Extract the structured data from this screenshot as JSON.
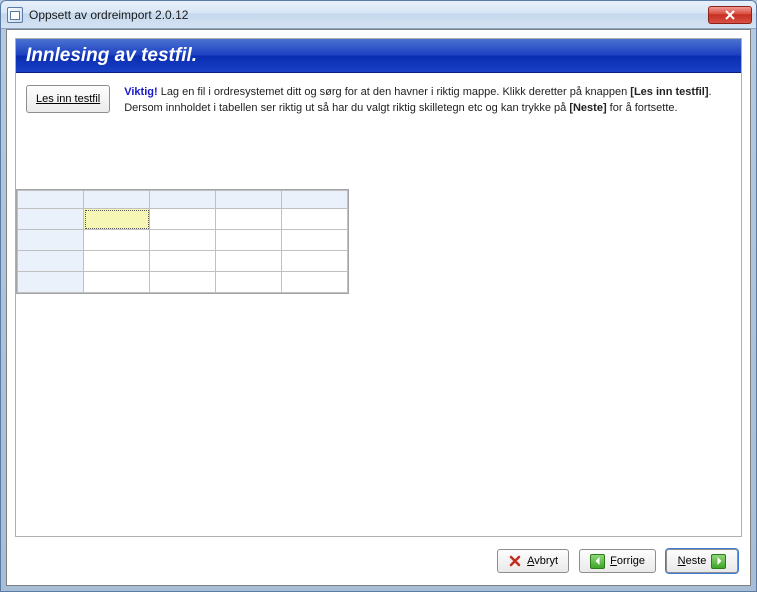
{
  "window": {
    "title": "Oppsett av ordreimport 2.0.12"
  },
  "banner": {
    "title": "Innlesing av testfil."
  },
  "load_button": {
    "label": "Les inn testfil",
    "accel_char": "L"
  },
  "info": {
    "important": "Viktig!",
    "line1_a": " Lag en fil i ordresystemet ditt og sørg for at den havner i riktig mappe. Klikk deretter på knappen ",
    "line1_b": "[Les inn testfil]",
    "line1_c": ". Dersom innholdet i tabellen ser riktig ut så har du valgt riktig skilletegn etc og kan trykke på ",
    "line1_d": "[Neste]",
    "line1_e": " for å fortsette."
  },
  "grid": {
    "cols": 5,
    "rows": 4,
    "selected": {
      "row": 0,
      "col": 0
    }
  },
  "footer": {
    "cancel": "Avbryt",
    "prev": "Forrige",
    "next": "Neste"
  }
}
